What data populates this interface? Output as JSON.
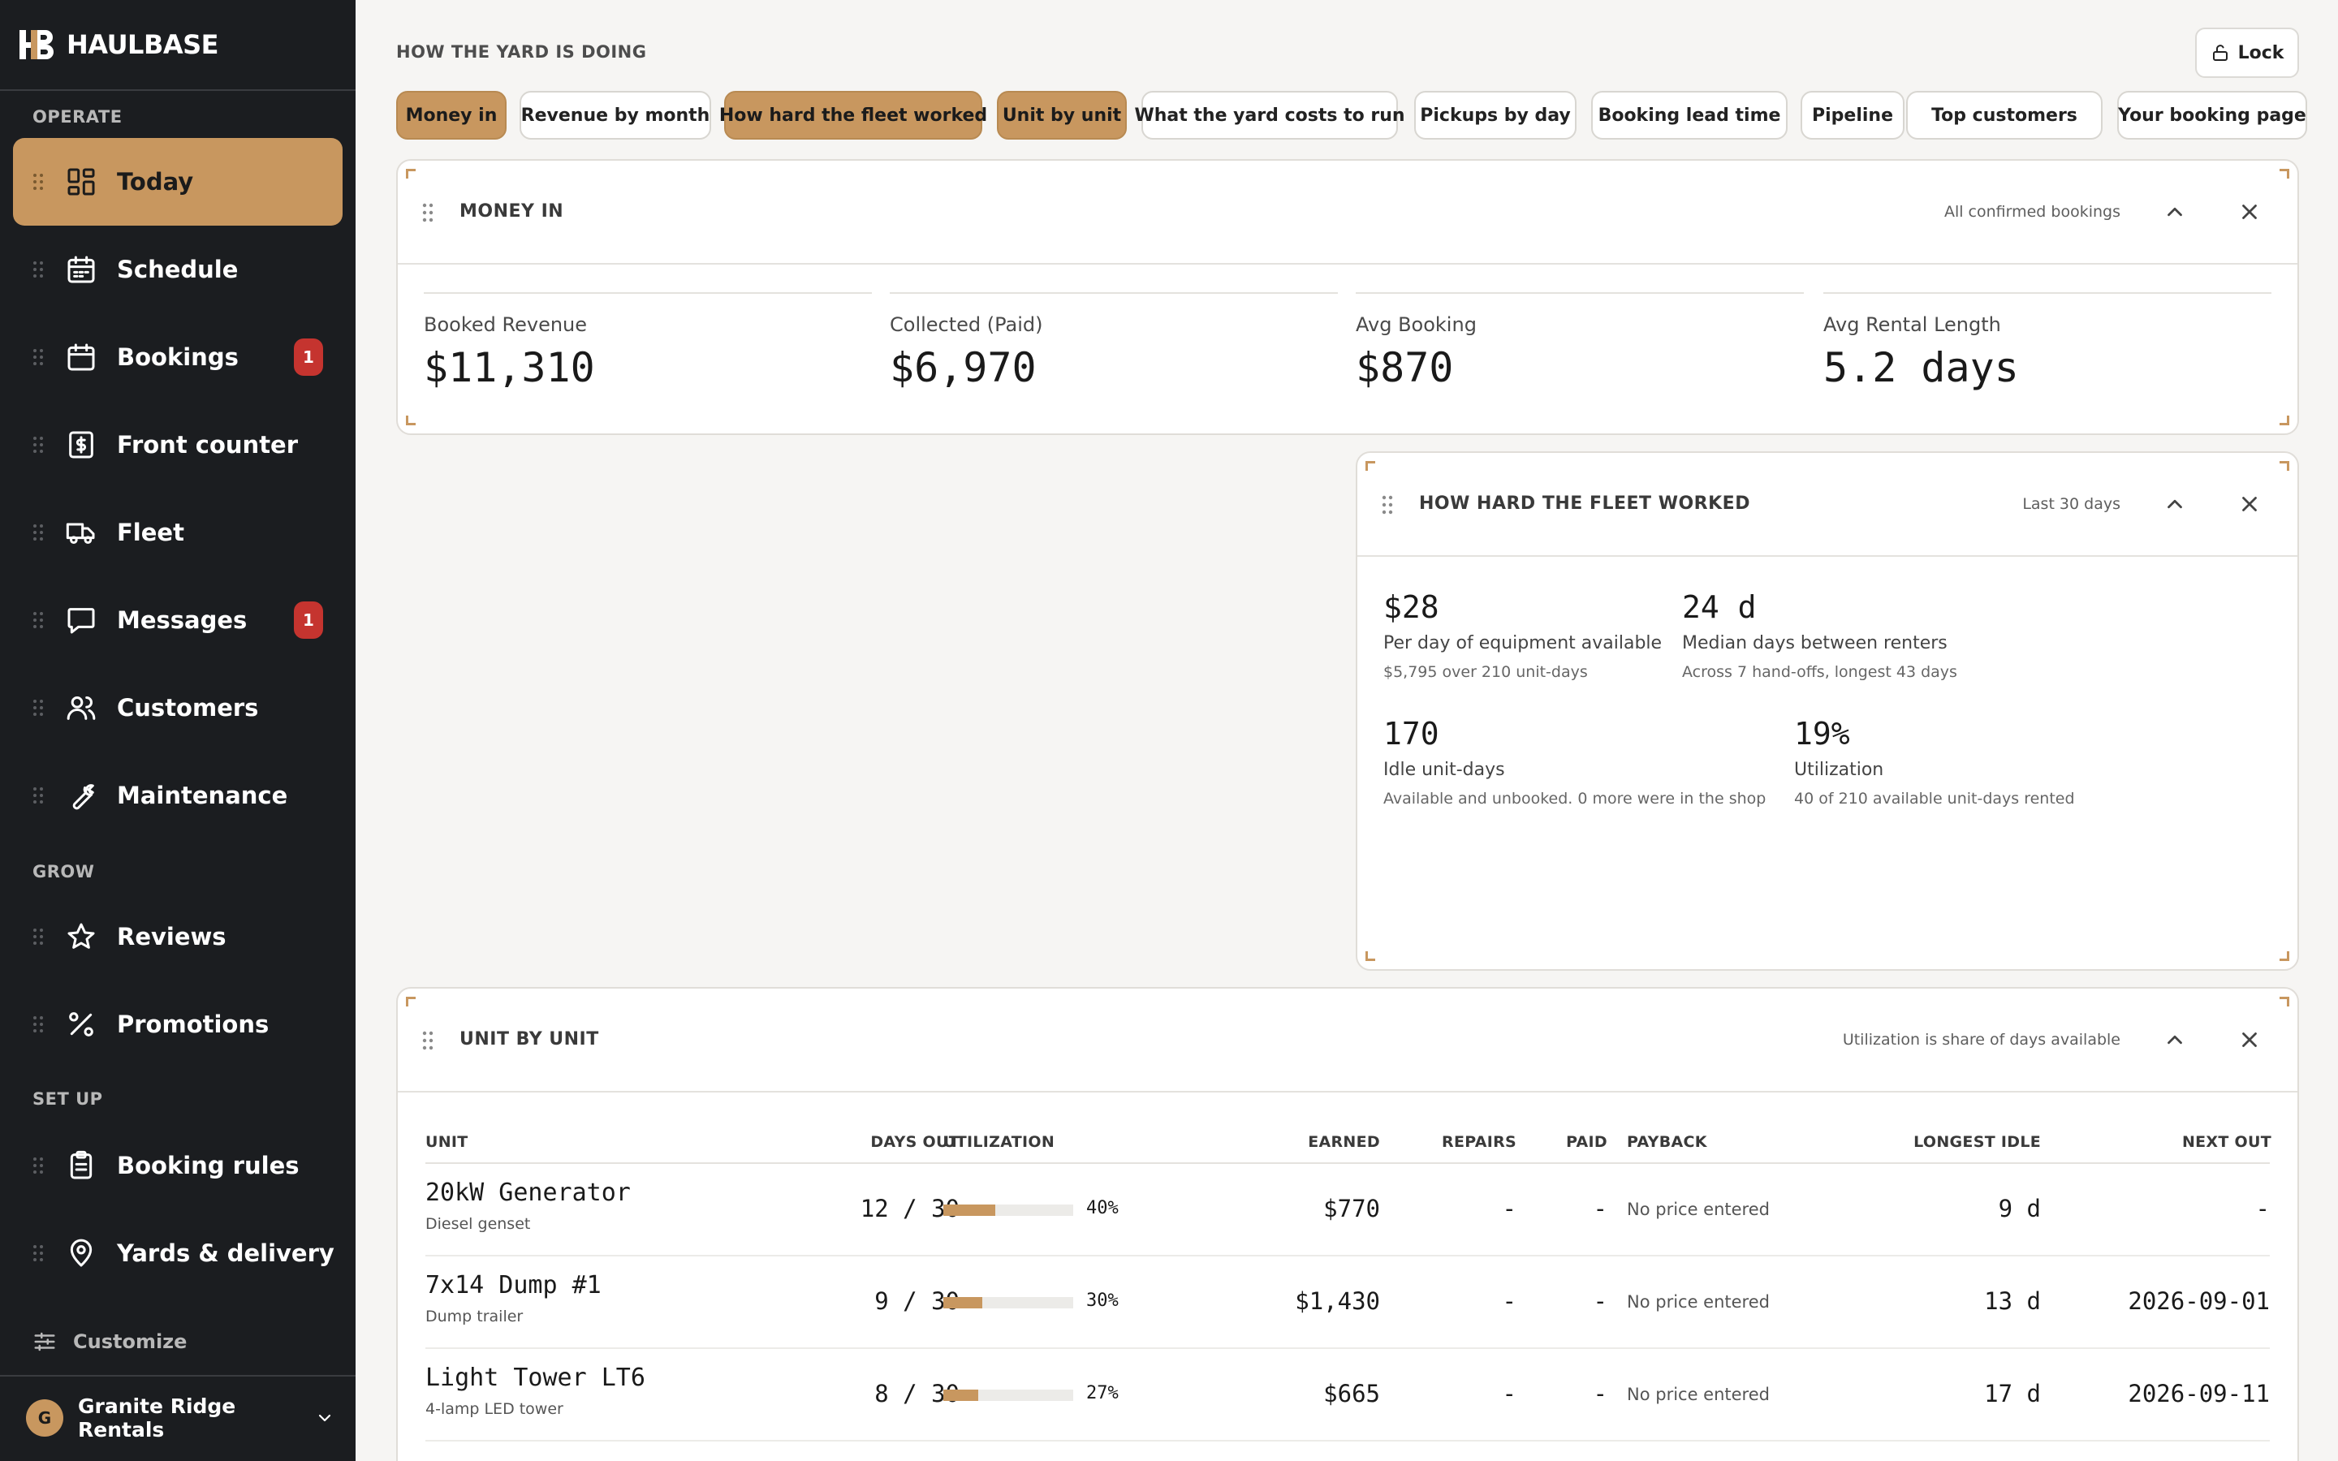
{
  "app": {
    "name": "HAULBASE"
  },
  "sidebar": {
    "sections": [
      {
        "label": "OPERATE"
      },
      {
        "label": "GROW"
      },
      {
        "label": "SET UP"
      }
    ],
    "items": [
      {
        "label": "Today",
        "icon": "dashboard-icon",
        "active": true
      },
      {
        "label": "Schedule",
        "icon": "calendar-grid-icon"
      },
      {
        "label": "Bookings",
        "icon": "calendar-icon",
        "badge": "1"
      },
      {
        "label": "Front counter",
        "icon": "dollar-receipt-icon"
      },
      {
        "label": "Fleet",
        "icon": "truck-icon"
      },
      {
        "label": "Messages",
        "icon": "message-icon",
        "badge": "1"
      },
      {
        "label": "Customers",
        "icon": "users-icon"
      },
      {
        "label": "Maintenance",
        "icon": "wrench-icon"
      },
      {
        "label": "Reviews",
        "icon": "star-icon"
      },
      {
        "label": "Promotions",
        "icon": "percent-icon"
      },
      {
        "label": "Booking rules",
        "icon": "clipboard-icon"
      },
      {
        "label": "Yards & delivery",
        "icon": "map-pin-icon"
      }
    ],
    "customize_label": "Customize",
    "account": {
      "initial": "G",
      "name": "Granite Ridge Rentals"
    }
  },
  "header": {
    "title": "HOW THE YARD IS DOING",
    "lock_label": "Lock"
  },
  "chips": [
    {
      "label": "Money in",
      "on": true
    },
    {
      "label": "Revenue by month",
      "on": false
    },
    {
      "label": "How hard the fleet worked",
      "on": true
    },
    {
      "label": "Unit by unit",
      "on": true
    },
    {
      "label": "What the yard costs to run",
      "on": false
    },
    {
      "label": "Pickups by day",
      "on": false
    },
    {
      "label": "Booking lead time",
      "on": false
    },
    {
      "label": "Pipeline",
      "on": false
    },
    {
      "label": "Top customers",
      "on": false
    },
    {
      "label": "Your booking page",
      "on": false
    }
  ],
  "money_in": {
    "title": "MONEY IN",
    "note": "All confirmed bookings",
    "stats": [
      {
        "label": "Booked Revenue",
        "value": "$11,310"
      },
      {
        "label": "Collected (Paid)",
        "value": "$6,970"
      },
      {
        "label": "Avg Booking",
        "value": "$870"
      },
      {
        "label": "Avg Rental Length",
        "value": "5.2 days"
      }
    ]
  },
  "fleet": {
    "title": "HOW HARD THE FLEET WORKED",
    "note": "Last 30 days",
    "stats": [
      {
        "value": "$28",
        "label": "Per day of equipment available",
        "sub": "$5,795 over 210 unit-days"
      },
      {
        "value": "24 d",
        "label": "Median days between renters",
        "sub": "Across 7 hand-offs, longest 43 days"
      },
      {
        "value": "170",
        "label": "Idle unit-days",
        "sub": "Available and unbooked. 0 more were in the shop"
      },
      {
        "value": "19%",
        "label": "Utilization",
        "sub": "40 of 210 available unit-days rented"
      }
    ]
  },
  "units": {
    "title": "UNIT BY UNIT",
    "note": "Utilization is share of days available",
    "columns": [
      "UNIT",
      "DAYS OUT",
      "UTILIZATION",
      "EARNED",
      "REPAIRS",
      "PAID",
      "PAYBACK",
      "LONGEST IDLE",
      "NEXT OUT"
    ],
    "rows": [
      {
        "name": "20kW Generator",
        "type": "Diesel genset",
        "days_out": "12 / 30",
        "util": 0.4,
        "util_label": "40%",
        "earned": "$770",
        "repairs": "-",
        "paid": "-",
        "payback": "No price entered",
        "longest_idle": "9 d",
        "next_out": "-"
      },
      {
        "name": "7x14 Dump #1",
        "type": "Dump trailer",
        "days_out": "9 / 30",
        "util": 0.3,
        "util_label": "30%",
        "earned": "$1,430",
        "repairs": "-",
        "paid": "-",
        "payback": "No price entered",
        "longest_idle": "13 d",
        "next_out": "2026-09-01"
      },
      {
        "name": "Light Tower LT6",
        "type": "4-lamp LED tower",
        "days_out": "8 / 30",
        "util": 0.27,
        "util_label": "27%",
        "earned": "$665",
        "repairs": "-",
        "paid": "-",
        "payback": "No price entered",
        "longest_idle": "17 d",
        "next_out": "2026-09-11"
      }
    ]
  },
  "colors": {
    "accent": "#c8975f",
    "sidebar": "#1b1d20",
    "badge": "#c5342f",
    "background": "#f6f5f3"
  }
}
